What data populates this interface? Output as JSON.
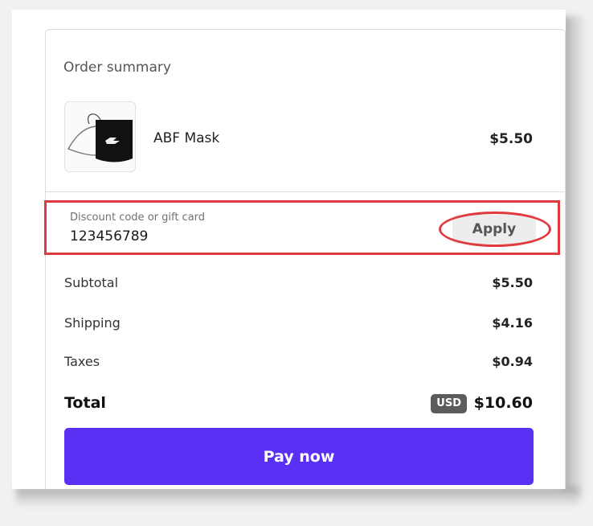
{
  "order_summary": {
    "title": "Order summary",
    "item": {
      "name": "ABF Mask",
      "price": "$5.50",
      "thumbnail_icon": "mask-product-image"
    }
  },
  "discount": {
    "label": "Discount code or gift card",
    "value": "123456789",
    "apply_label": "Apply",
    "highlight_color": "#e0393e"
  },
  "totals": {
    "subtotal": {
      "label": "Subtotal",
      "value": "$5.50"
    },
    "shipping": {
      "label": "Shipping",
      "value": "$4.16"
    },
    "taxes": {
      "label": "Taxes",
      "value": "$0.94"
    },
    "total": {
      "label": "Total",
      "currency": "USD",
      "value": "$10.60"
    }
  },
  "checkout": {
    "pay_label": "Pay now",
    "pay_color": "#5a31f4"
  }
}
